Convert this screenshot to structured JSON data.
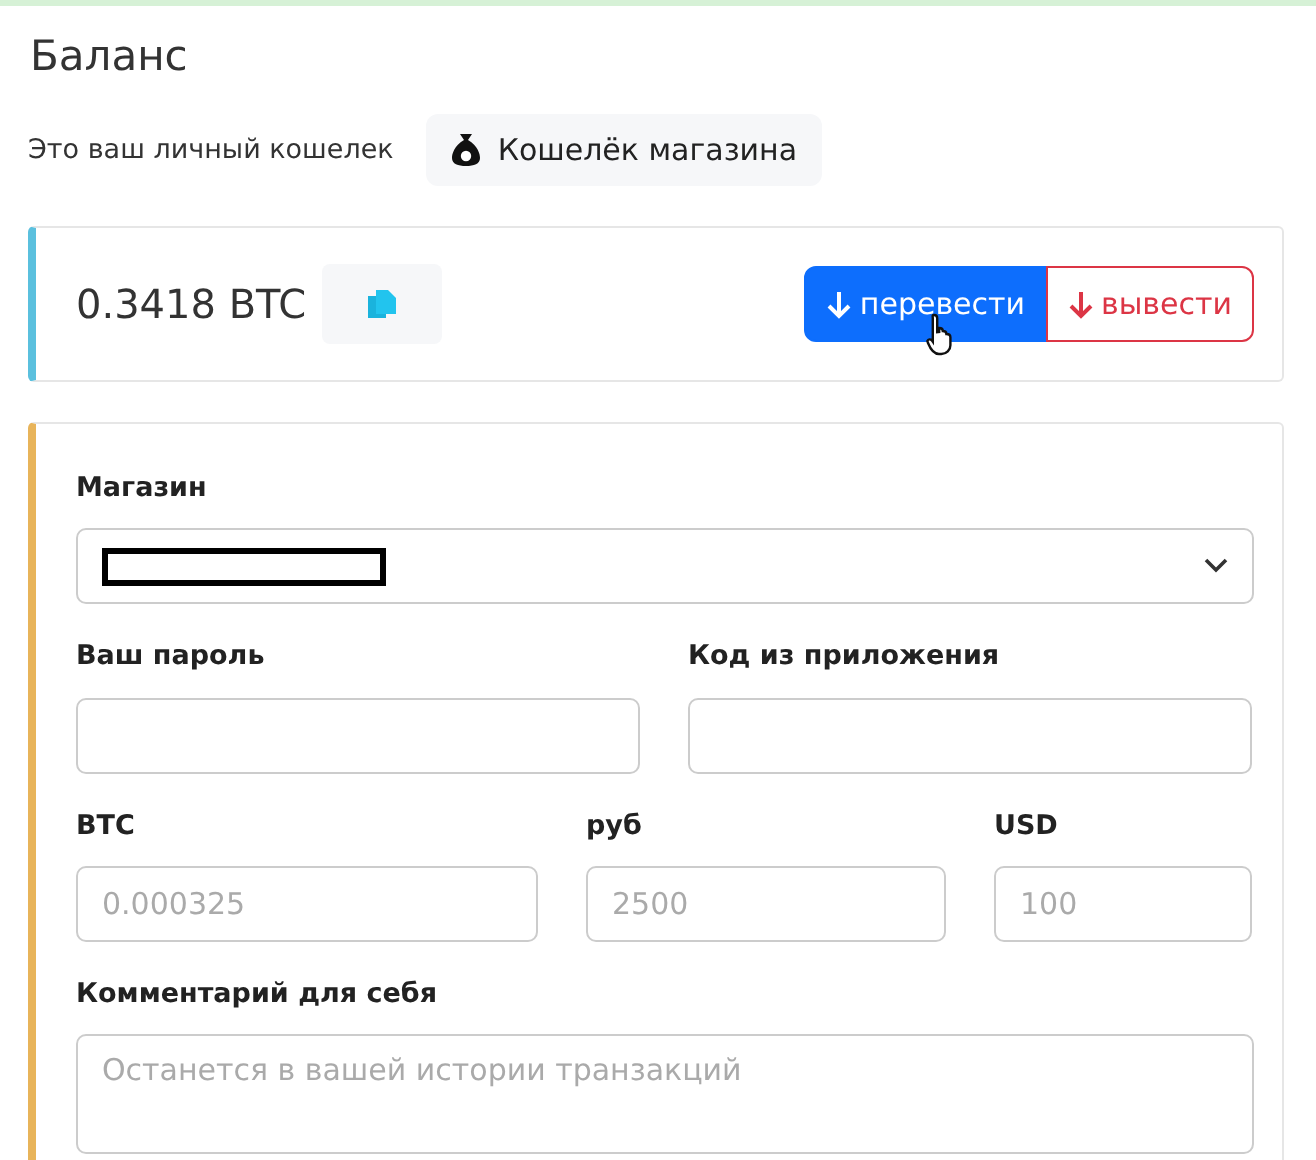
{
  "title": "Баланс",
  "wallet": {
    "caption": "Это ваш личный кошелек",
    "button": "Кошелёк магазина"
  },
  "balance": {
    "amount": "0.3418 BTC",
    "actions": [
      {
        "kind": "primary",
        "label": "перевести",
        "hovered": true
      },
      {
        "kind": "danger",
        "label": "вывести",
        "hovered": false
      }
    ]
  },
  "form": {
    "store": {
      "label": "Магазин",
      "value_redacted": true
    },
    "rows": [
      [
        {
          "label": "Ваш пароль"
        },
        {
          "label": "Код из приложения"
        }
      ],
      [
        {
          "label": "BTC",
          "placeholder": "0.000325"
        },
        {
          "label": "руб",
          "placeholder": "2500"
        },
        {
          "label": "USD",
          "placeholder": "100"
        }
      ]
    ],
    "comment": {
      "label": "Комментарий для себя",
      "placeholder": "Останется в вашей истории транзакций"
    }
  }
}
